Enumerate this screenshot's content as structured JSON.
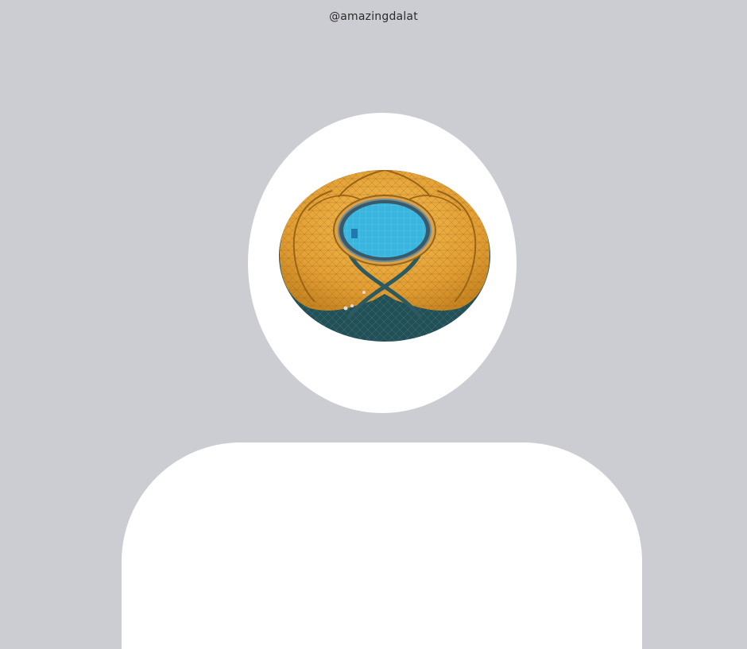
{
  "watermark": {
    "text": "@amazingdalat"
  },
  "avatar": {
    "image": "domed-building-aerial-photo",
    "colors": {
      "background": "#cccdd2",
      "silhouette": "#ffffff",
      "dome_gold": "#e8a93a",
      "pool_blue": "#38b6e0",
      "glass_teal": "#1f4f55"
    }
  }
}
